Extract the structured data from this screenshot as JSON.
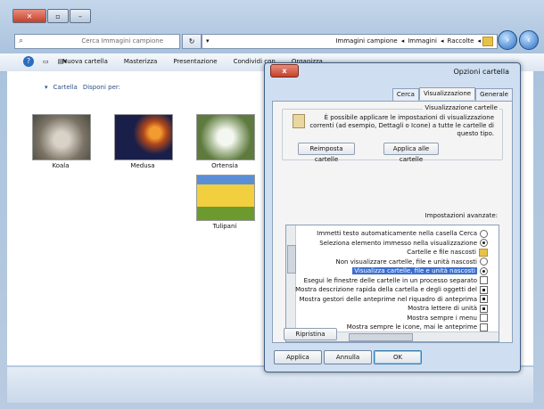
{
  "explorer": {
    "search_placeholder": "Cerca Immagini campione",
    "breadcrumbs": [
      "Raccolte",
      "Immagini",
      "Immagini campione"
    ],
    "toolbar_items": [
      "Organizza",
      "Condividi con",
      "Presentazione",
      "Masterizza",
      "Nuova cartella"
    ],
    "arrange_label": "Disponi per:",
    "arrange_value": "Cartella",
    "items": [
      {
        "label": "Koala",
        "color": "#7b7466"
      },
      {
        "label": "Medusa",
        "color": "#1a1f4a"
      },
      {
        "label": "Ortensia",
        "color": "#b7c6a6"
      },
      {
        "label": "Tulipani",
        "color": "#e7b53b"
      }
    ]
  },
  "dialog": {
    "title": "Opzioni cartella",
    "close_label": "x",
    "tabs": [
      "Generale",
      "Visualizzazione",
      "Cerca"
    ],
    "active_tab": "Visualizzazione",
    "group1_label": "Visualizzazione cartelle",
    "group1_text": "È possibile applicare le impostazioni di visualizzazione correnti (ad esempio, Dettagli o Icone) a tutte le cartelle di questo tipo.",
    "apply_folders": "Applica alle cartelle",
    "reset_folders": "Reimposta cartelle",
    "advanced_label": "Impostazioni avanzate:",
    "settings": [
      {
        "type": "radio",
        "on": false,
        "text": "Immetti testo automaticamente nella casella Cerca"
      },
      {
        "type": "radio",
        "on": true,
        "text": "Seleziona elemento immesso nella visualizzazione"
      },
      {
        "type": "folder",
        "on": false,
        "text": "Cartelle e file nascosti"
      },
      {
        "type": "radio",
        "on": false,
        "text": "Non visualizzare cartelle, file e unità nascosti"
      },
      {
        "type": "radio",
        "on": true,
        "text": "Visualizza cartelle, file e unità nascosti",
        "selected": true
      },
      {
        "type": "check",
        "on": false,
        "text": "Esegui le finestre delle cartelle in un processo separato"
      },
      {
        "type": "check",
        "on": true,
        "text": "Mostra descrizione rapida della cartella e degli oggetti del"
      },
      {
        "type": "check",
        "on": true,
        "text": "Mostra gestori delle anteprime nel riquadro di anteprima"
      },
      {
        "type": "check",
        "on": true,
        "text": "Mostra lettere di unità"
      },
      {
        "type": "check",
        "on": false,
        "text": "Mostra sempre i menu"
      },
      {
        "type": "check",
        "on": false,
        "text": "Mostra sempre le icone, mai le anteprime"
      }
    ],
    "restore_defaults": "Ripristina",
    "buttons": {
      "ok": "OK",
      "cancel": "Annulla",
      "apply": "Applica"
    }
  }
}
